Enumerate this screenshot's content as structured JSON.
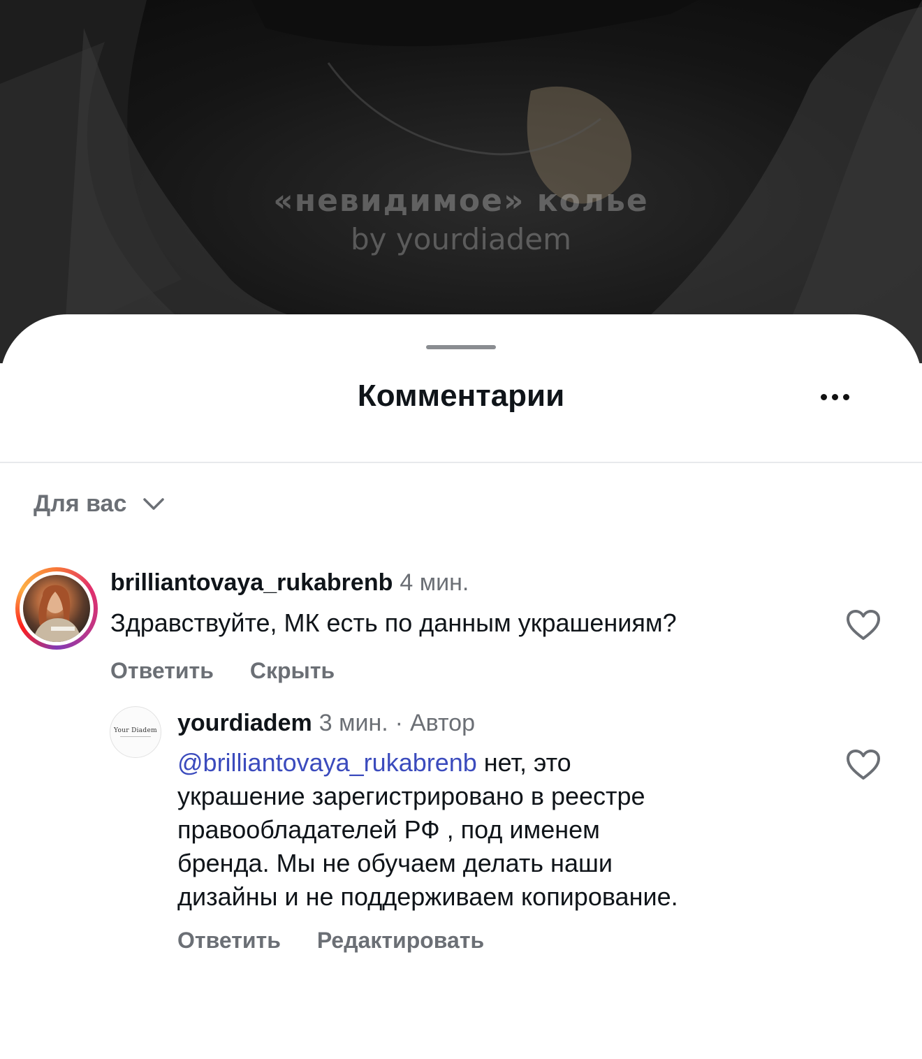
{
  "video": {
    "title": "«невидимое» колье",
    "subtitle": "by yourdiadem"
  },
  "sheet": {
    "title": "Комментарии",
    "sort_label": "Для вас"
  },
  "comments": [
    {
      "username": "brilliantovaya_rukabrenb",
      "time": "4 мин.",
      "text": "Здравствуйте, МК есть по данным украшениям?",
      "actions": {
        "reply": "Ответить",
        "secondary": "Скрыть"
      }
    }
  ],
  "reply": {
    "username": "yourdiadem",
    "time": "3 мин.",
    "separator": "·",
    "badge": "Автор",
    "avatar_text": "Your Diadem",
    "mention": "@brilliantovaya_rukabrenb",
    "text_lines": [
      " нет, это",
      "украшение зарегистрировано в реестре",
      "правообладателей РФ , под именем",
      "бренда. Мы не обучаем делать наши",
      "дизайны и не поддерживаем копирование."
    ],
    "actions": {
      "reply": "Ответить",
      "secondary": "Редактировать"
    }
  },
  "icons": {
    "more": "more-horizontal-icon",
    "sort": "chevron-down-icon",
    "like": "heart-outline-icon"
  },
  "colors": {
    "mention": "#3b4bbd",
    "muted": "#6b6f75",
    "text": "#0f1419"
  }
}
